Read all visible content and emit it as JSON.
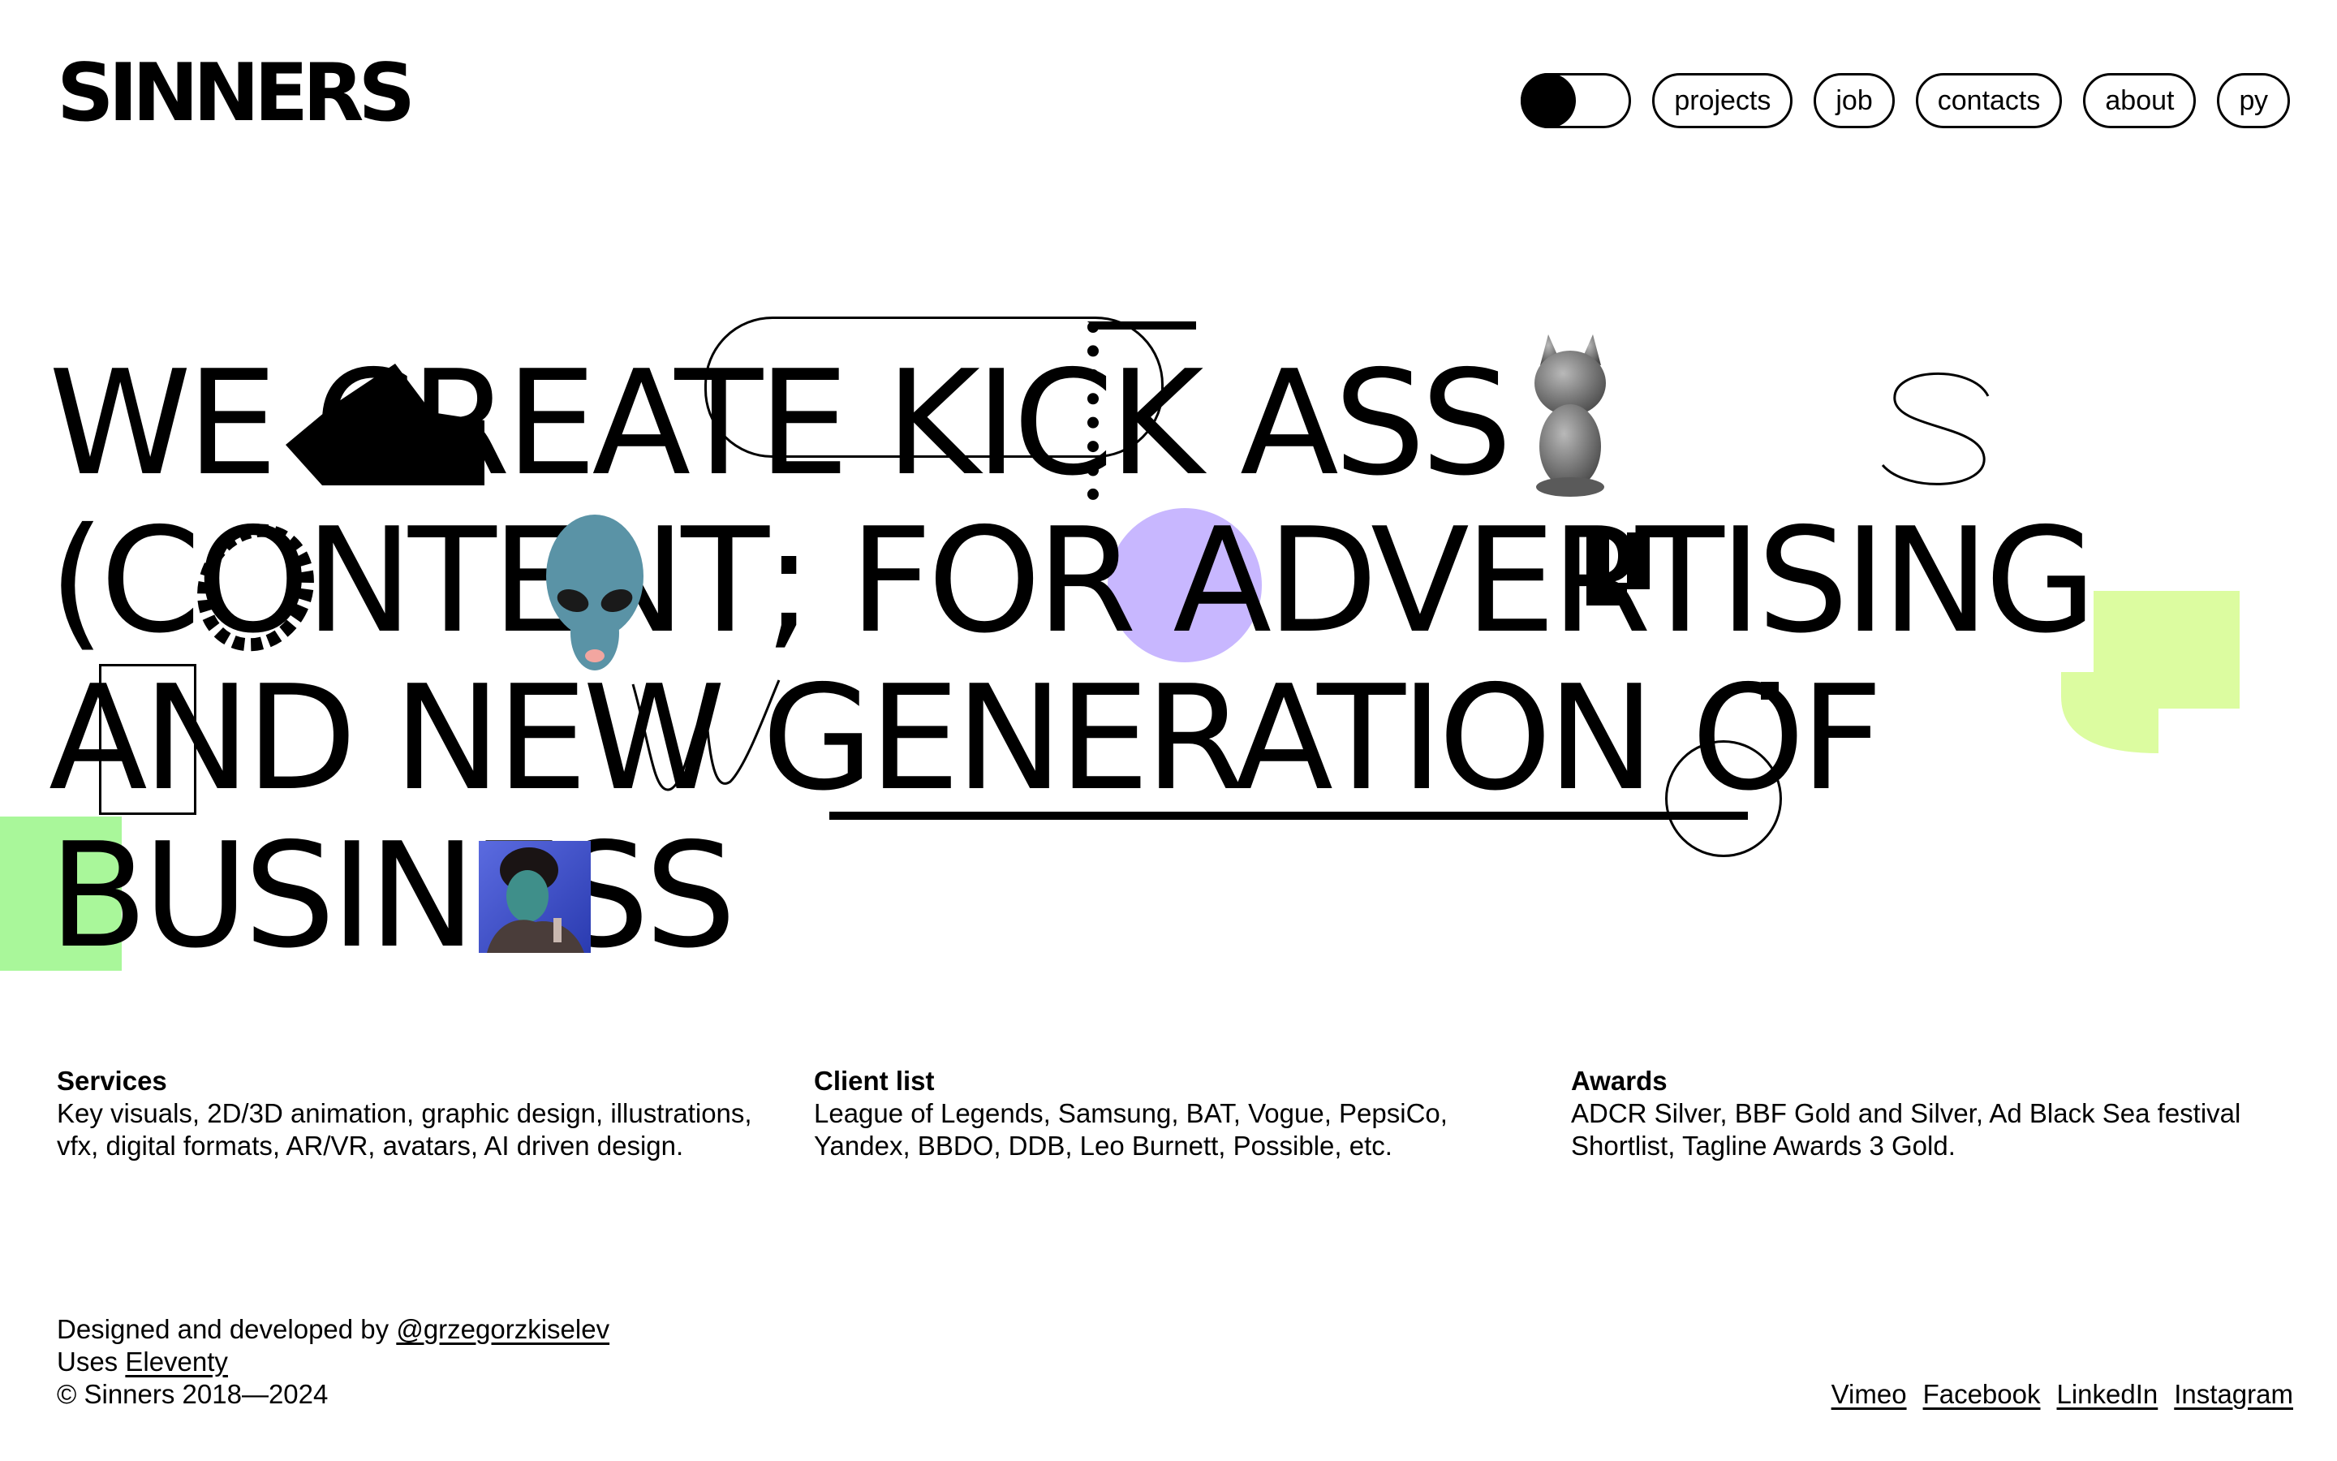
{
  "header": {
    "logo": "SINNERS",
    "nav": [
      {
        "label": "projects"
      },
      {
        "label": "job"
      },
      {
        "label": "contacts"
      },
      {
        "label": "about"
      },
      {
        "label": "ру"
      }
    ]
  },
  "hero": {
    "lines": [
      "WE CREATE KICK ASS",
      "(CONTENT; FOR ADVERTISING",
      "AND NEW GENERATION OF",
      "BUSINESS"
    ]
  },
  "info": {
    "services": {
      "title": "Services",
      "line1": "Key visuals, 2D/3D animation, graphic design, illustrations,",
      "line2": "vfx, digital formats, AR/VR, avatars, AI driven design."
    },
    "clients": {
      "title": "Client list",
      "line1": "League of Legends, Samsung, BAT, Vogue, PepsiCo,",
      "line2": "Yandex, BBDO, DDB, Leo Burnett, Possible, etc."
    },
    "awards": {
      "title": "Awards",
      "line1": "ADCR Silver, BBF Gold and Silver, Ad Black Sea festival",
      "line2": "Shortlist, Tagline Awards 3 Gold."
    }
  },
  "footer": {
    "designed_prefix": "Designed and developed by ",
    "designer_handle": "@grzegorzkiselev",
    "uses_prefix": "Uses ",
    "uses_link": "Eleventy",
    "copyright": "© Sinners 2018—2024",
    "social": [
      "Vimeo",
      "Facebook",
      "LinkedIn",
      "Instagram"
    ]
  },
  "colors": {
    "lilac": "#c8b7ff",
    "lime": "#dcfca0",
    "green": "#a9f79a",
    "alien": "#5a93a6"
  },
  "icons": [
    "theme-toggle-icon",
    "devil-figurine-icon",
    "alien-head-icon",
    "portrait-photo"
  ]
}
